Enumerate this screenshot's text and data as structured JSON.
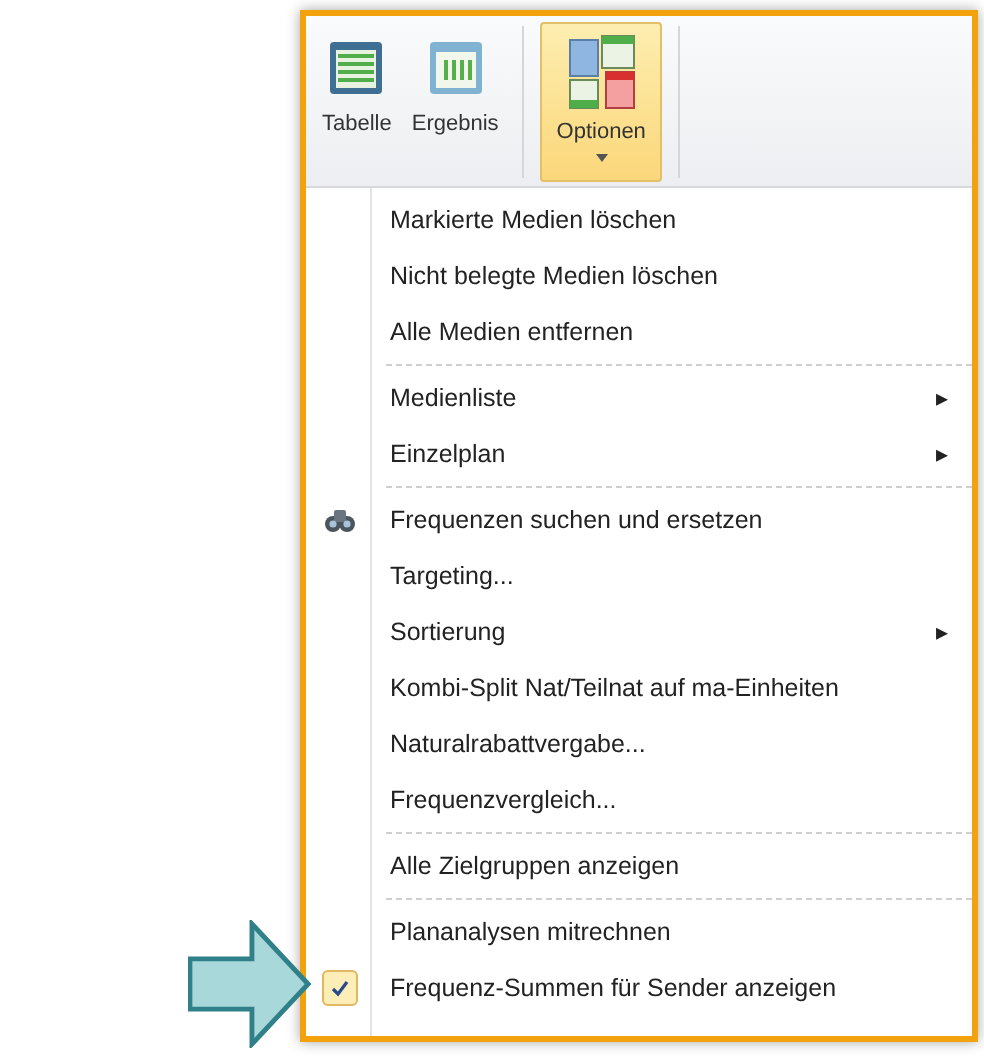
{
  "ribbon": {
    "buttons": [
      {
        "label": "Tabelle",
        "kind": "table",
        "selected": false,
        "dropdown": false
      },
      {
        "label": "Ergebnis",
        "kind": "result",
        "selected": false,
        "dropdown": false
      },
      {
        "label": "Optionen",
        "kind": "options",
        "selected": true,
        "dropdown": true
      }
    ]
  },
  "menu": {
    "items": [
      {
        "kind": "item",
        "label": "Markierte Medien löschen",
        "checked": false
      },
      {
        "kind": "item",
        "label": "Nicht belegte Medien löschen",
        "checked": false
      },
      {
        "kind": "item",
        "label": "Alle Medien entfernen",
        "checked": false
      },
      {
        "kind": "separator"
      },
      {
        "kind": "submenu",
        "label": "Medienliste",
        "submenu_arrow": "▸"
      },
      {
        "kind": "submenu",
        "label": "Einzelplan",
        "submenu_arrow": "▸"
      },
      {
        "kind": "separator"
      },
      {
        "kind": "tool",
        "label": "Frequenzen suchen und ersetzen",
        "checked": false
      },
      {
        "kind": "item",
        "label": "Targeting...",
        "checked": false
      },
      {
        "kind": "submenu",
        "label": "Sortierung",
        "submenu_arrow": "▸"
      },
      {
        "kind": "item",
        "label": "Kombi-Split Nat/Teilnat auf ma-Einheiten",
        "checked": false
      },
      {
        "kind": "item",
        "label": "Naturalrabattvergabe...",
        "checked": false
      },
      {
        "kind": "item",
        "label": "Frequenzvergleich...",
        "checked": false
      },
      {
        "kind": "separator"
      },
      {
        "kind": "item",
        "label": "Alle Zielgruppen anzeigen",
        "checked": false
      },
      {
        "kind": "separator"
      },
      {
        "kind": "item",
        "label": "Plananalysen mitrechnen",
        "checked": false
      },
      {
        "kind": "item",
        "label": "Frequenz-Summen für Sender anzeigen",
        "checked": true
      }
    ]
  }
}
